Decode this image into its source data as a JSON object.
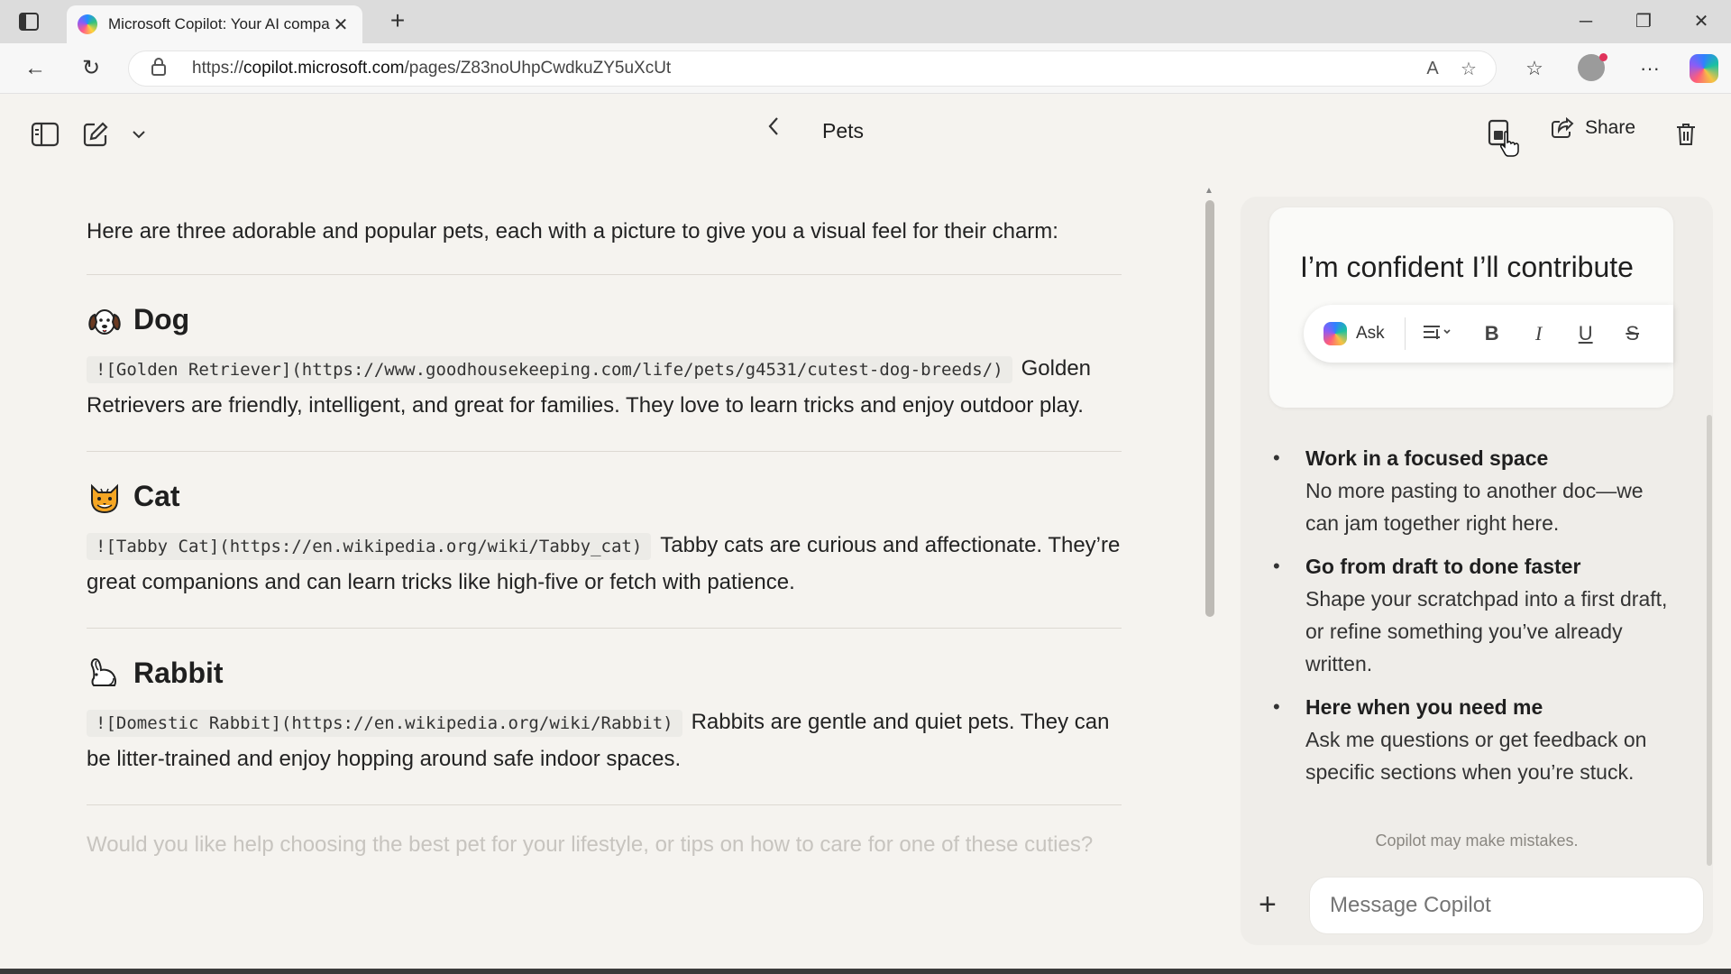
{
  "browser": {
    "tab_title": "Microsoft Copilot: Your AI compa",
    "url_prefix": "https://",
    "url_host": "copilot.microsoft.com",
    "url_path": "/pages/Z83noUhpCwdkuZY5uXcUt"
  },
  "header": {
    "title": "Pets",
    "share_label": "Share"
  },
  "content": {
    "intro": "Here are three adorable and popular pets, each with a picture to give you a visual feel for their charm:",
    "pets": [
      {
        "name": "Dog",
        "emoji": "dog-face-icon",
        "code": "![Golden Retriever](https://www.goodhousekeeping.com/life/pets/g4531/cutest-dog-breeds/)",
        "text": "Golden Retrievers are friendly, intelligent, and great for families. They love to learn tricks and enjoy outdoor play."
      },
      {
        "name": "Cat",
        "emoji": "cat-face-icon",
        "code": "![Tabby Cat](https://en.wikipedia.org/wiki/Tabby_cat)",
        "text": "Tabby cats are curious and affectionate. They’re great companions and can learn tricks like high-five or fetch with patience."
      },
      {
        "name": "Rabbit",
        "emoji": "rabbit-icon",
        "code": "![Domestic Rabbit](https://en.wikipedia.org/wiki/Rabbit)",
        "text": "Rabbits are gentle and quiet pets. They can be litter-trained and enjoy hopping around safe indoor spaces."
      }
    ],
    "followup": "Would you like help choosing the best pet for your lifestyle, or tips on how to care for one of these cuties?"
  },
  "panel": {
    "draft_text": "I’m confident I’ll contribute",
    "ask_label": "Ask",
    "features": [
      {
        "title": "Work in a focused space",
        "desc": "No more pasting to another doc—we can jam together right here."
      },
      {
        "title": "Go from draft to done faster",
        "desc": "Shape your scratchpad into a first draft, or refine something you’ve already written."
      },
      {
        "title": "Here when you need me",
        "desc": "Ask me questions or get feedback on specific sections when you’re stuck."
      }
    ],
    "disclaimer": "Copilot may make mistakes.",
    "input_placeholder": "Message Copilot"
  }
}
